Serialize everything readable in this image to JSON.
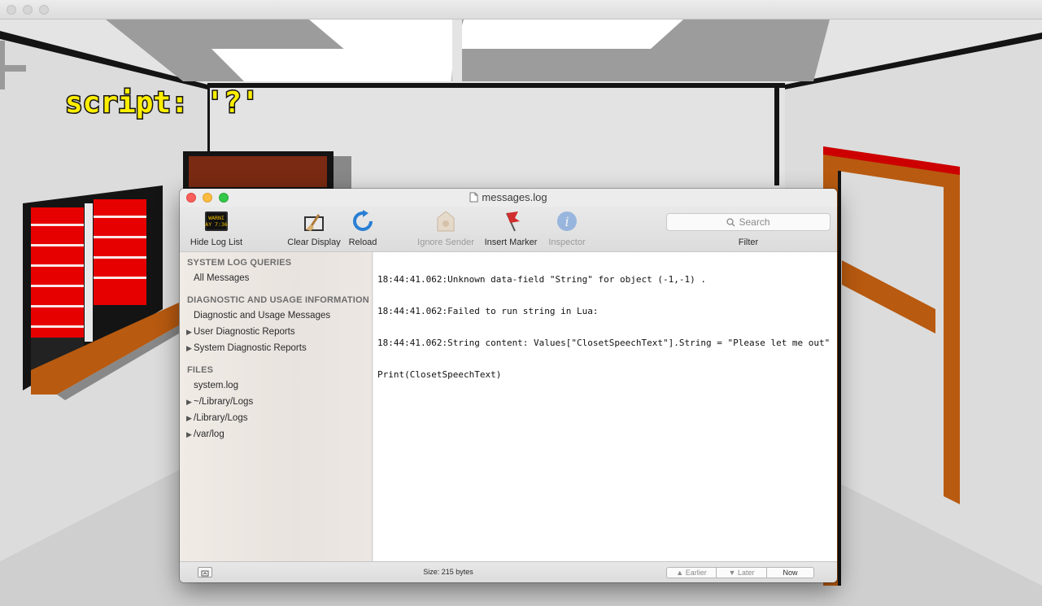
{
  "game": {
    "overlay_text": "script: '?'"
  },
  "console": {
    "title": "messages.log",
    "toolbar": {
      "hide_log_list": "Hide Log List",
      "clear_display": "Clear Display",
      "reload": "Reload",
      "ignore_sender": "Ignore Sender",
      "insert_marker": "Insert Marker",
      "inspector": "Inspector",
      "search_placeholder": "Search",
      "filter": "Filter",
      "warning_icon_text_top": "WARNI",
      "warning_icon_text_bottom": "AY 7:36"
    },
    "sidebar": {
      "system_log_queries": "SYSTEM LOG QUERIES",
      "all_messages": "All Messages",
      "diagnostic_header": "DIAGNOSTIC AND USAGE INFORMATION",
      "diagnostic_messages": "Diagnostic and Usage Messages",
      "user_reports": "User Diagnostic Reports",
      "system_reports": "System Diagnostic Reports",
      "files_header": "FILES",
      "system_log": "system.log",
      "user_library_logs": "~/Library/Logs",
      "library_logs": "/Library/Logs",
      "var_log": "/var/log"
    },
    "log_lines": [
      "18:44:41.062:Unknown data-field \"String\" for object (-1,-1) .",
      "18:44:41.062:Failed to run string in Lua:",
      "18:44:41.062:String content: Values[\"ClosetSpeechText\"].String = \"Please let me out\"",
      "Print(ClosetSpeechText)"
    ],
    "status": {
      "size": "Size: 215 bytes",
      "earlier": "Earlier",
      "later": "Later",
      "now": "Now"
    }
  }
}
